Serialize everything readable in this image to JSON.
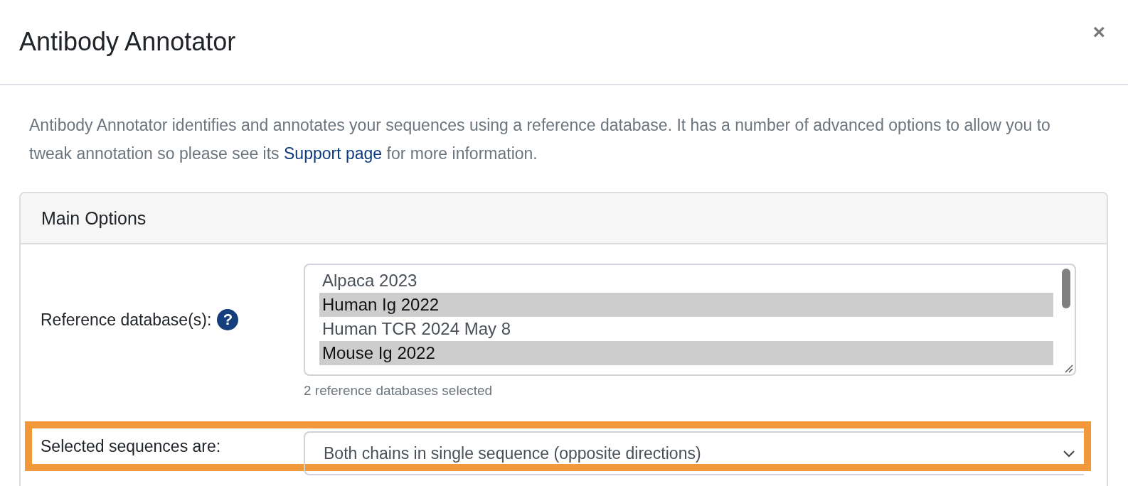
{
  "dialog": {
    "title": "Antibody Annotator",
    "close": "×"
  },
  "description": {
    "before": "Antibody Annotator identifies and annotates your sequences using a reference database. It has a number of advanced options to allow you to tweak annotation so please see its ",
    "link": "Support page",
    "after": " for more information."
  },
  "panel": {
    "title": "Main Options",
    "reference": {
      "label": "Reference database(s):",
      "help": "?",
      "options": [
        {
          "label": "Alpaca 2023",
          "selected": false
        },
        {
          "label": "Human Ig 2022",
          "selected": true
        },
        {
          "label": "Human TCR 2024 May 8",
          "selected": false
        },
        {
          "label": "Mouse Ig 2022",
          "selected": true
        }
      ],
      "hint": "2 reference databases selected"
    },
    "sequences": {
      "label": "Selected sequences are:",
      "value": "Both chains in single sequence (opposite directions)",
      "highlighted": true
    }
  }
}
